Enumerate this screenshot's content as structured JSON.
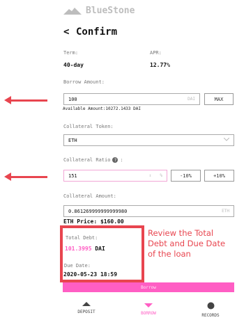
{
  "app": {
    "name": "BlueStone"
  },
  "header": {
    "back": "<",
    "title": "Confirm"
  },
  "term": {
    "label": "Term:",
    "value": "40-day"
  },
  "apr": {
    "label": "APR:",
    "value": "12.77%"
  },
  "borrow_amount": {
    "label": "Borrow Amount:",
    "value": "100",
    "unit": "DAI",
    "max_label": "MAX",
    "available": "Available Amount:10272.1433 DAI"
  },
  "collateral_token": {
    "label": "Collateral Token:",
    "value": "ETH"
  },
  "collateral_ratio": {
    "label": "Collateral Ratio",
    "help": "?",
    "suffix": ":",
    "value": "151",
    "stepper": "⇕",
    "unit": "%",
    "minus_label": "-10%",
    "plus_label": "+10%"
  },
  "collateral_amount": {
    "label": "Collateral Amount:",
    "value": "0.861269999999999980",
    "unit": "ETH"
  },
  "eth_price": "ETH Price: $160.00",
  "total_debt": {
    "label": "Total Debt:",
    "value": "101.3995",
    "unit": "DAI"
  },
  "due_date": {
    "label": "Due Date:",
    "value": "2020-05-23 18:59"
  },
  "annotation": "Review the Total Debt and Due Date of the loan",
  "borrow_button": "Borrow",
  "nav": [
    {
      "label": "DEPOSIT",
      "icon": "triangle-up-icon"
    },
    {
      "label": "BORROW",
      "icon": "triangle-down-icon",
      "active": true
    },
    {
      "label": "RECORDS",
      "icon": "circle-icon"
    }
  ],
  "colors": {
    "accent": "#ff5ec4",
    "annotation": "#e8454f",
    "logo": "#bdbdbd"
  }
}
